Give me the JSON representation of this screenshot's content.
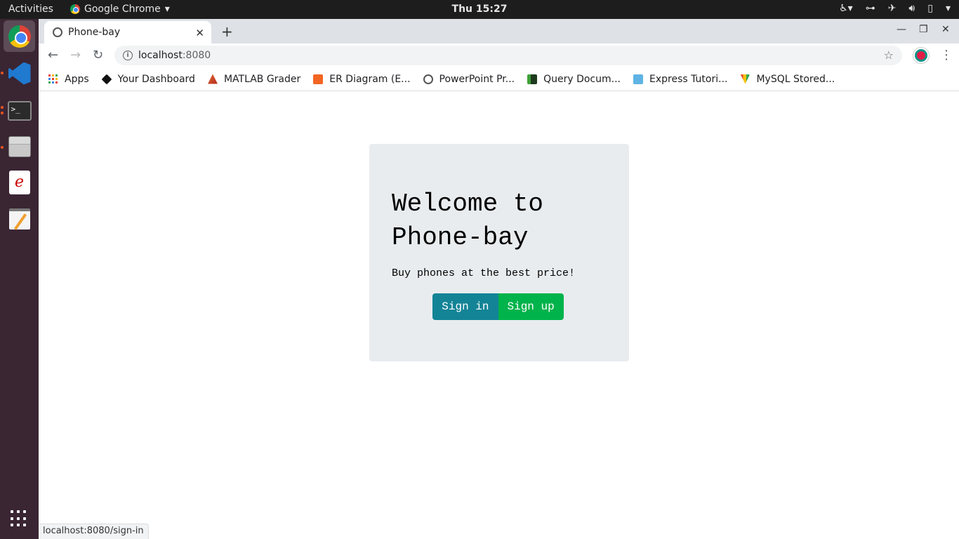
{
  "topbar": {
    "activities": "Activities",
    "app_name": "Google Chrome",
    "clock": "Thu 15:27"
  },
  "browser": {
    "tab_title": "Phone-bay",
    "url_host": "localhost",
    "url_port": ":8080",
    "bookmarks": [
      {
        "label": "Apps",
        "icon": "apps-grid-icon"
      },
      {
        "label": "Your Dashboard",
        "icon": "dashboard-icon"
      },
      {
        "label": "MATLAB Grader",
        "icon": "matlab-icon"
      },
      {
        "label": "ER Diagram (E...",
        "icon": "er-diagram-icon"
      },
      {
        "label": "PowerPoint Pr...",
        "icon": "globe-icon"
      },
      {
        "label": "Query Docum...",
        "icon": "mongodb-icon"
      },
      {
        "label": "Express Tutori...",
        "icon": "express-icon"
      },
      {
        "label": "MySQL Stored...",
        "icon": "mysql-icon"
      }
    ],
    "status_url": "localhost:8080/sign-in"
  },
  "page": {
    "heading": "Welcome to Phone-bay",
    "tagline": "Buy phones at the best price!",
    "signin_label": "Sign in",
    "signup_label": "Sign up"
  },
  "colors": {
    "signin": "#138496",
    "signup": "#00b34b",
    "jumbotron": "#e9ecef"
  }
}
